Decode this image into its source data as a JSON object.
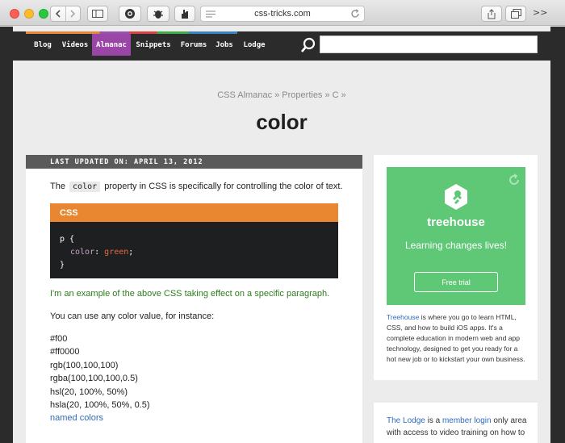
{
  "browser": {
    "url": "css-tricks.com",
    "more_label": ">>"
  },
  "nav": {
    "items": [
      "Blog",
      "Videos",
      "Almanac",
      "Snippets",
      "Forums",
      "Jobs",
      "Lodge"
    ],
    "active": "Almanac",
    "search_placeholder": ""
  },
  "breadcrumb": "CSS Almanac » Properties » C »",
  "title": "color",
  "article": {
    "updated": "LAST UPDATED ON: APRIL 13, 2012",
    "intro_before": "The",
    "intro_code": "color",
    "intro_after": "property in CSS is specifically for controlling the color of text.",
    "code_lang": "CSS",
    "code_line1": "p {",
    "code_prop": "color",
    "code_colon": ":",
    "code_val": "green",
    "code_semicolon": ";",
    "code_line3": "}",
    "example_text": "I'm an example of the above CSS taking effect on a specific paragraph.",
    "values_intro": "You can use any color value, for instance:",
    "values": [
      "#f00",
      "#ff0000",
      "rgb(100,100,100)",
      "rgba(100,100,100,0.5)",
      "hsl(20, 100%, 50%)",
      "hsla(20, 100%, 50%, 0.5)"
    ],
    "named_link": "named colors"
  },
  "ad": {
    "brand": "treehouse",
    "tagline": "Learning changes lives!",
    "button": "Free trial",
    "desc_link": "Treehouse",
    "desc": " is where you go to learn HTML, CSS, and how to build iOS apps. It's a complete education in modern web and app technology, designed to get you ready for a hot new job or to kickstart your own business."
  },
  "lodge": {
    "link1": "The Lodge",
    "text1": " is a ",
    "link2": "member login",
    "text2": " only area with access to video training on how to"
  },
  "colors": {
    "nav_bg": "#2b2b2b",
    "nav_active": "#9a46a7",
    "code_header": "#e8872f",
    "treehouse_green": "#5ec877",
    "example_green": "#2c7d1b",
    "link": "#2f6bbd"
  }
}
